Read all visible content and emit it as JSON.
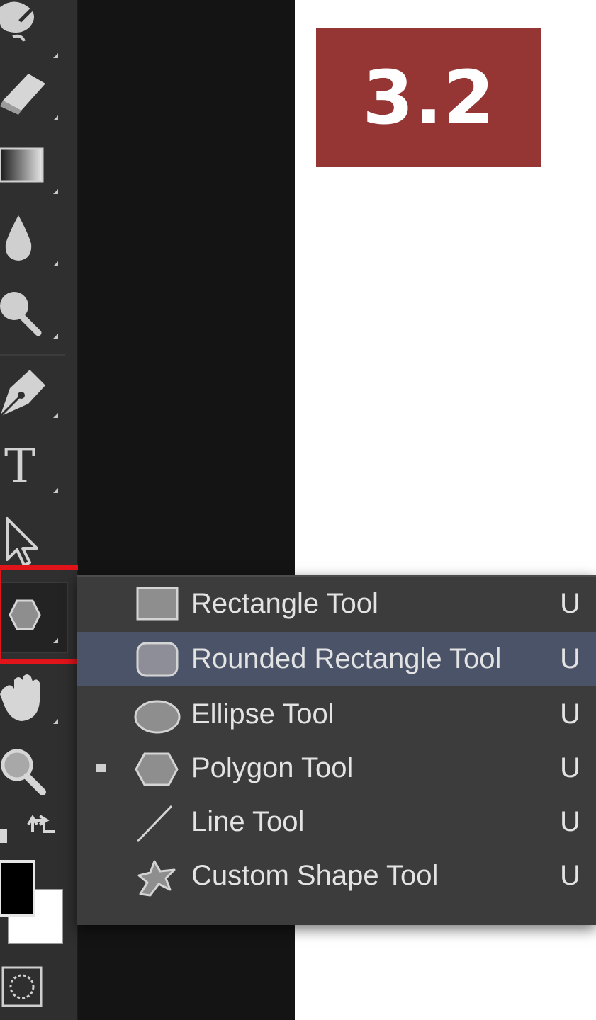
{
  "badge": {
    "text": "3.2"
  },
  "toolbar": {
    "icons": [
      "paint-brush-icon",
      "eraser-icon",
      "gradient-icon",
      "blur-drop-icon",
      "dodge-icon",
      "pen-icon",
      "type-icon",
      "path-selection-icon",
      "polygon-shape-icon",
      "hand-icon",
      "zoom-icon",
      "swap-colors-icon",
      "color-swatches-icon",
      "quick-mask-icon"
    ],
    "type_glyph": "T",
    "highlight_color": "#e1141a"
  },
  "shape_menu": {
    "items": [
      {
        "label": "Rectangle Tool",
        "shortcut": "U",
        "icon": "rectangle-icon",
        "hovered": false,
        "current": false
      },
      {
        "label": "Rounded Rectangle Tool",
        "shortcut": "U",
        "icon": "rounded-rectangle-icon",
        "hovered": true,
        "current": false
      },
      {
        "label": "Ellipse Tool",
        "shortcut": "U",
        "icon": "ellipse-icon",
        "hovered": false,
        "current": false
      },
      {
        "label": "Polygon Tool",
        "shortcut": "U",
        "icon": "polygon-icon",
        "hovered": false,
        "current": true
      },
      {
        "label": "Line Tool",
        "shortcut": "U",
        "icon": "line-icon",
        "hovered": false,
        "current": false
      },
      {
        "label": "Custom Shape Tool",
        "shortcut": "U",
        "icon": "custom-shape-icon",
        "hovered": false,
        "current": false
      }
    ]
  },
  "colors": {
    "badge_bg": "#953635",
    "menu_bg": "#3c3c3c",
    "menu_hover": "#4a5368",
    "toolbar_bg": "#2f2f2f"
  }
}
